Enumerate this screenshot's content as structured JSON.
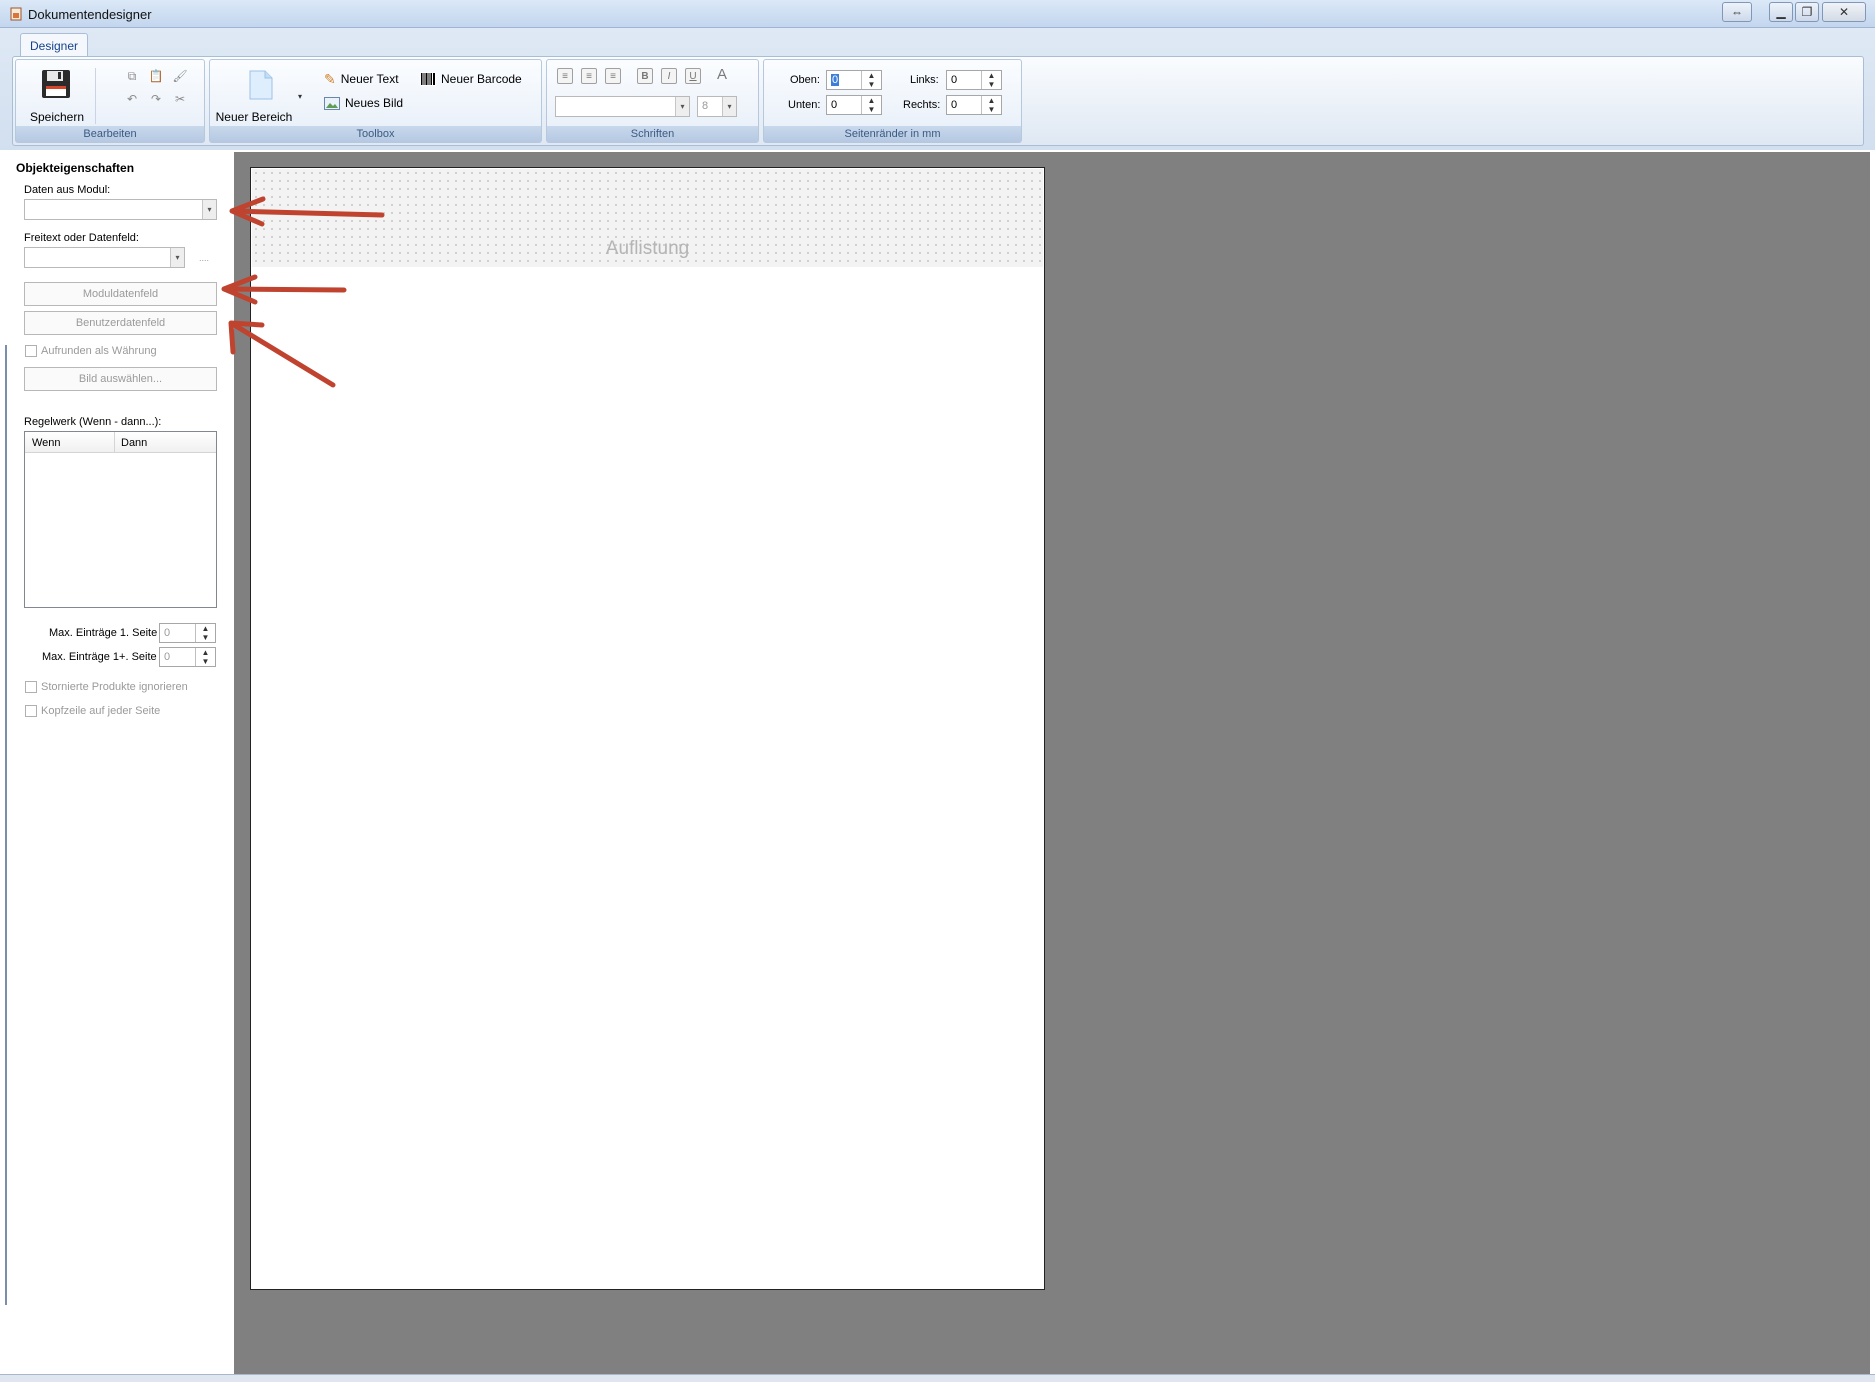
{
  "window": {
    "title": "Dokumentendesigner",
    "buttons": [
      "swap-icon",
      "minimize-icon",
      "restore-icon",
      "close-icon"
    ]
  },
  "ribbon": {
    "tab": "Designer",
    "groups": {
      "bearbeiten": {
        "caption": "Bearbeiten",
        "save_label": "Speichern",
        "icons": [
          "copy-icon",
          "paste-icon",
          "format-painter-icon",
          "undo-icon",
          "redo-icon",
          "cut-icon"
        ]
      },
      "toolbox": {
        "caption": "Toolbox",
        "new_area": "Neuer Bereich",
        "new_text": "Neuer Text",
        "new_image": "Neues Bild",
        "new_barcode": "Neuer Barcode"
      },
      "schriften": {
        "caption": "Schriften",
        "font_name": "",
        "font_size": "8",
        "buttons": [
          "align-left-icon",
          "align-center-icon",
          "align-right-icon",
          "bold-icon",
          "italic-icon",
          "underline-icon",
          "font-color-icon"
        ]
      },
      "margins": {
        "caption": "Seitenränder in mm",
        "top_label": "Oben:",
        "top": "0",
        "bottom_label": "Unten:",
        "bottom": "0",
        "left_label": "Links:",
        "left": "0",
        "right_label": "Rechts:",
        "right": "0"
      }
    }
  },
  "properties": {
    "title": "Objekteigenschaften",
    "module_label": "Daten aus Modul:",
    "module_value": "",
    "field_label": "Freitext oder Datenfeld:",
    "field_value": "",
    "field_browse": "....",
    "module_field_button": "Moduldatenfeld",
    "user_field_button": "Benutzerdatenfeld",
    "round_currency": "Aufrunden als Währung",
    "select_image_button": "Bild auswählen...",
    "rules_label": "Regelwerk (Wenn - dann...):",
    "rules_columns": [
      "Wenn",
      "Dann"
    ],
    "max_first_label": "Max. Einträge 1. Seite",
    "max_first": "0",
    "max_next_label": "Max. Einträge 1+. Seite",
    "max_next": "0",
    "ignore_cancelled": "Stornierte Produkte ignorieren",
    "header_each_page": "Kopfzeile auf jeder Seite"
  },
  "canvas": {
    "band_label": "Auflistung"
  },
  "annotations": {
    "arrow_color": "#c0432f"
  }
}
